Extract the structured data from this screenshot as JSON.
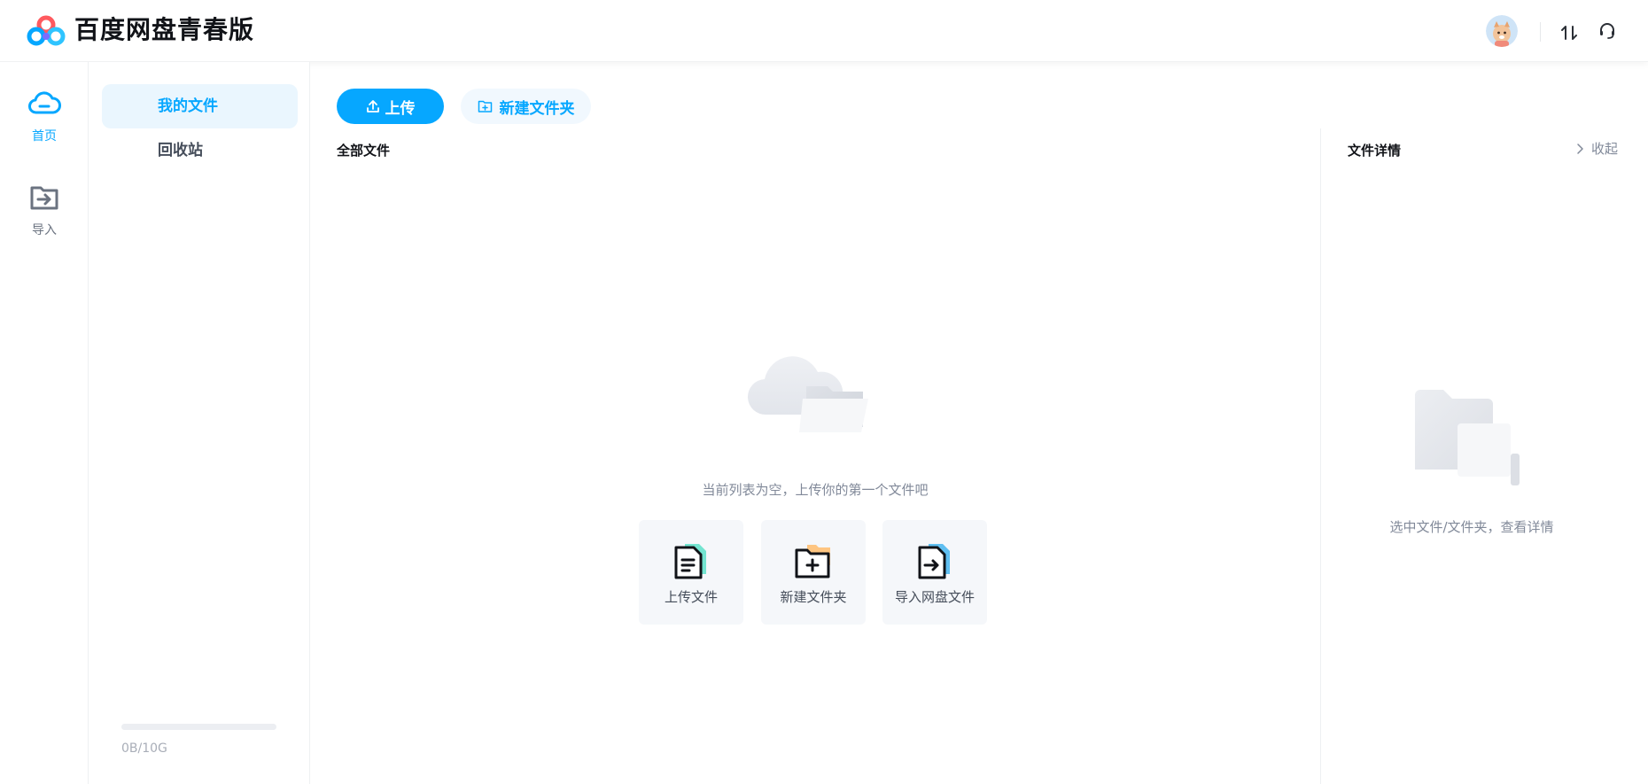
{
  "header": {
    "app_title": "百度网盘青春版",
    "logo_icon": "baidu-netdisk-logo-icon",
    "transfer_icon": "transfer-arrows-icon",
    "support_icon": "headset-icon"
  },
  "rail": {
    "items": [
      {
        "label": "首页",
        "icon": "cloud-home-icon",
        "active": true
      },
      {
        "label": "导入",
        "icon": "import-folder-icon",
        "active": false
      }
    ]
  },
  "sidebar": {
    "items": [
      {
        "label": "我的文件",
        "active": true
      },
      {
        "label": "回收站",
        "active": false
      }
    ],
    "quota": {
      "text": "0B/10G",
      "used_fraction": 0
    }
  },
  "toolbar": {
    "upload_label": "上传",
    "new_folder_label": "新建文件夹"
  },
  "main": {
    "breadcrumb": "全部文件",
    "empty_text": "当前列表为空，上传你的第一个文件吧",
    "actions": [
      {
        "label": "上传文件",
        "icon": "upload-file-icon"
      },
      {
        "label": "新建文件夹",
        "icon": "new-folder-icon"
      },
      {
        "label": "导入网盘文件",
        "icon": "import-file-icon"
      }
    ]
  },
  "details": {
    "title": "文件详情",
    "collapse_label": "收起",
    "empty_text": "选中文件/文件夹，查看详情"
  },
  "colors": {
    "accent": "#06a7ff",
    "accent_light": "#eaf6fe",
    "muted_text": "#818999"
  }
}
